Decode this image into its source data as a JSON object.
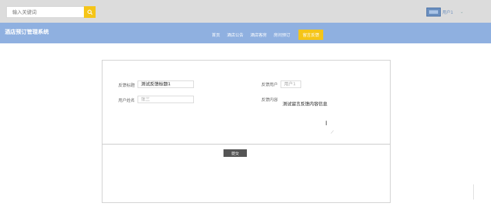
{
  "header": {
    "search_placeholder": "输入关键词",
    "user_label": "用户1",
    "user_arrow": "⌄"
  },
  "navbar": {
    "logo": "酒店预订管理系统",
    "items": [
      {
        "label": "首页"
      },
      {
        "label": "酒店公告"
      },
      {
        "label": "酒店客房"
      },
      {
        "label": "房间预订"
      },
      {
        "label": "留言反馈"
      }
    ],
    "active_index": 4
  },
  "form": {
    "title_label": "反馈标题",
    "title_value": "测试反馈标题1",
    "feedback_user_label": "反馈用户",
    "feedback_user_value": "用户1",
    "user_name_label": "用户姓名",
    "user_name_value": "张三",
    "content_label": "反馈内容",
    "content_value": "测试留言反馈内容信息",
    "submit_label": "提交"
  },
  "colors": {
    "topbar": "#dcdcdc",
    "navbar": "#8fb0e0",
    "accent": "#f5c518",
    "submit": "#555555"
  }
}
